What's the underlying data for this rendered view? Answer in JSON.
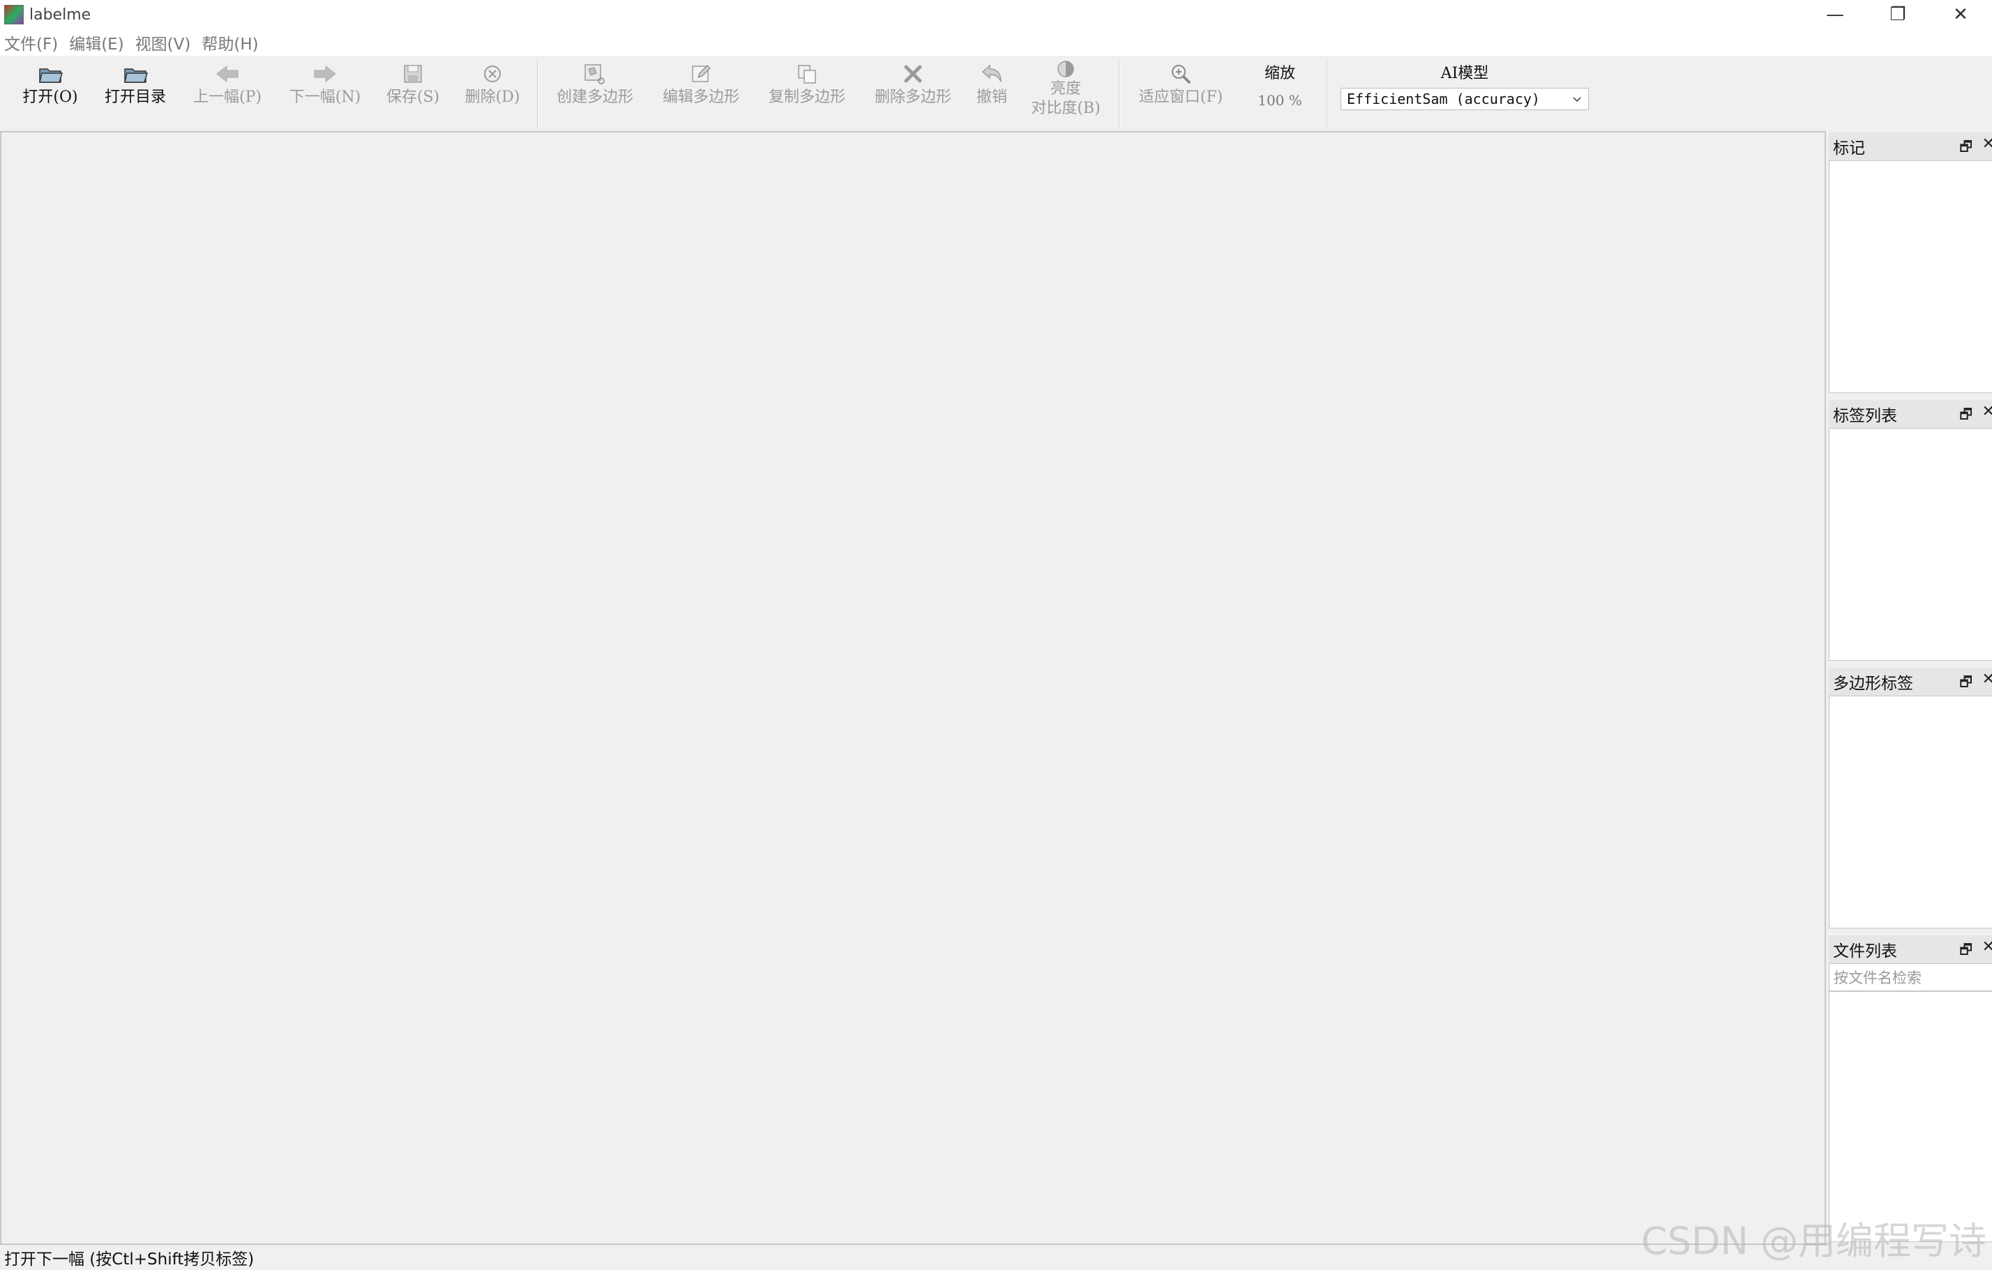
{
  "window": {
    "title": "labelme",
    "controls": {
      "minimize": "—",
      "restore": "❐",
      "close": "✕"
    }
  },
  "menu": [
    "文件(F)",
    "编辑(E)",
    "视图(V)",
    "帮助(H)"
  ],
  "toolbar": {
    "open": "打开(O)",
    "open_dir": "打开目录",
    "prev": "上一幅(P)",
    "next": "下一幅(N)",
    "save": "保存(S)",
    "delete": "删除(D)",
    "create_polygon": "创建多边形",
    "edit_polygon": "编辑多边形",
    "copy_polygon": "复制多边形",
    "delete_polygon": "删除多边形",
    "undo": "撤销",
    "brightness_line1": "亮度",
    "brightness_line2": "对比度(B)",
    "fit_window": "适应窗口(F)",
    "zoom_title": "缩放",
    "zoom_value": "100 %",
    "ai_title": "AI模型",
    "ai_model": "EfficientSam (accuracy)"
  },
  "docks": {
    "flags": "标记",
    "label_list": "标签列表",
    "polygon_labels": "多边形标签",
    "file_list": "文件列表",
    "file_search_placeholder": "按文件名检索"
  },
  "status": "打开下一幅 (按Ctl+Shift拷贝标签)",
  "watermark": "CSDN @用编程写诗"
}
